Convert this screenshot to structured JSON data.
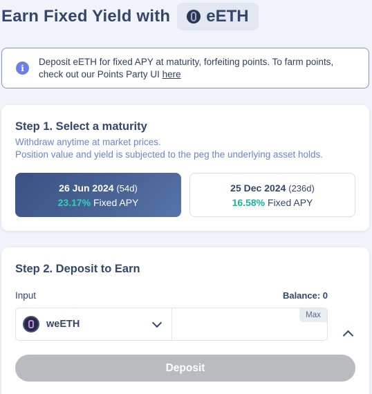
{
  "header": {
    "title": "Earn Fixed Yield with",
    "token": "eETH"
  },
  "notice": {
    "text": "Deposit eETH for fixed APY at maturity, forfeiting points. To farm points, check out our Points Party UI ",
    "link_text": "here"
  },
  "step1": {
    "title": "Step 1. Select a maturity",
    "subtitle_1": "Withdraw anytime at market prices.",
    "subtitle_2": "Position value and yield is subjected to the peg the underlying asset holds.",
    "maturities": [
      {
        "date": "26 Jun 2024",
        "days": "(54d)",
        "apy": "23.17%",
        "apy_label": "Fixed APY",
        "selected": true
      },
      {
        "date": "25 Dec 2024",
        "days": "(236d)",
        "apy": "16.58%",
        "apy_label": "Fixed APY",
        "selected": false
      }
    ]
  },
  "step2": {
    "title": "Step 2. Deposit to Earn",
    "input_label": "Input",
    "balance_label": "Balance: 0",
    "token": "weETH",
    "amount_value": "",
    "max_label": "Max",
    "deposit_label": "Deposit"
  },
  "colors": {
    "accent_apy": "#2fd3b8",
    "selected_card": "#3a5282",
    "info": "#6b7fe6",
    "disabled_button": "#b9bbbe"
  },
  "icons": {
    "token_pill": "eeth-logo-icon",
    "notice": "info-icon",
    "select_token": "weeth-logo-icon",
    "select_chevron": "chevron-down-icon",
    "collapse": "chevron-up-icon"
  }
}
